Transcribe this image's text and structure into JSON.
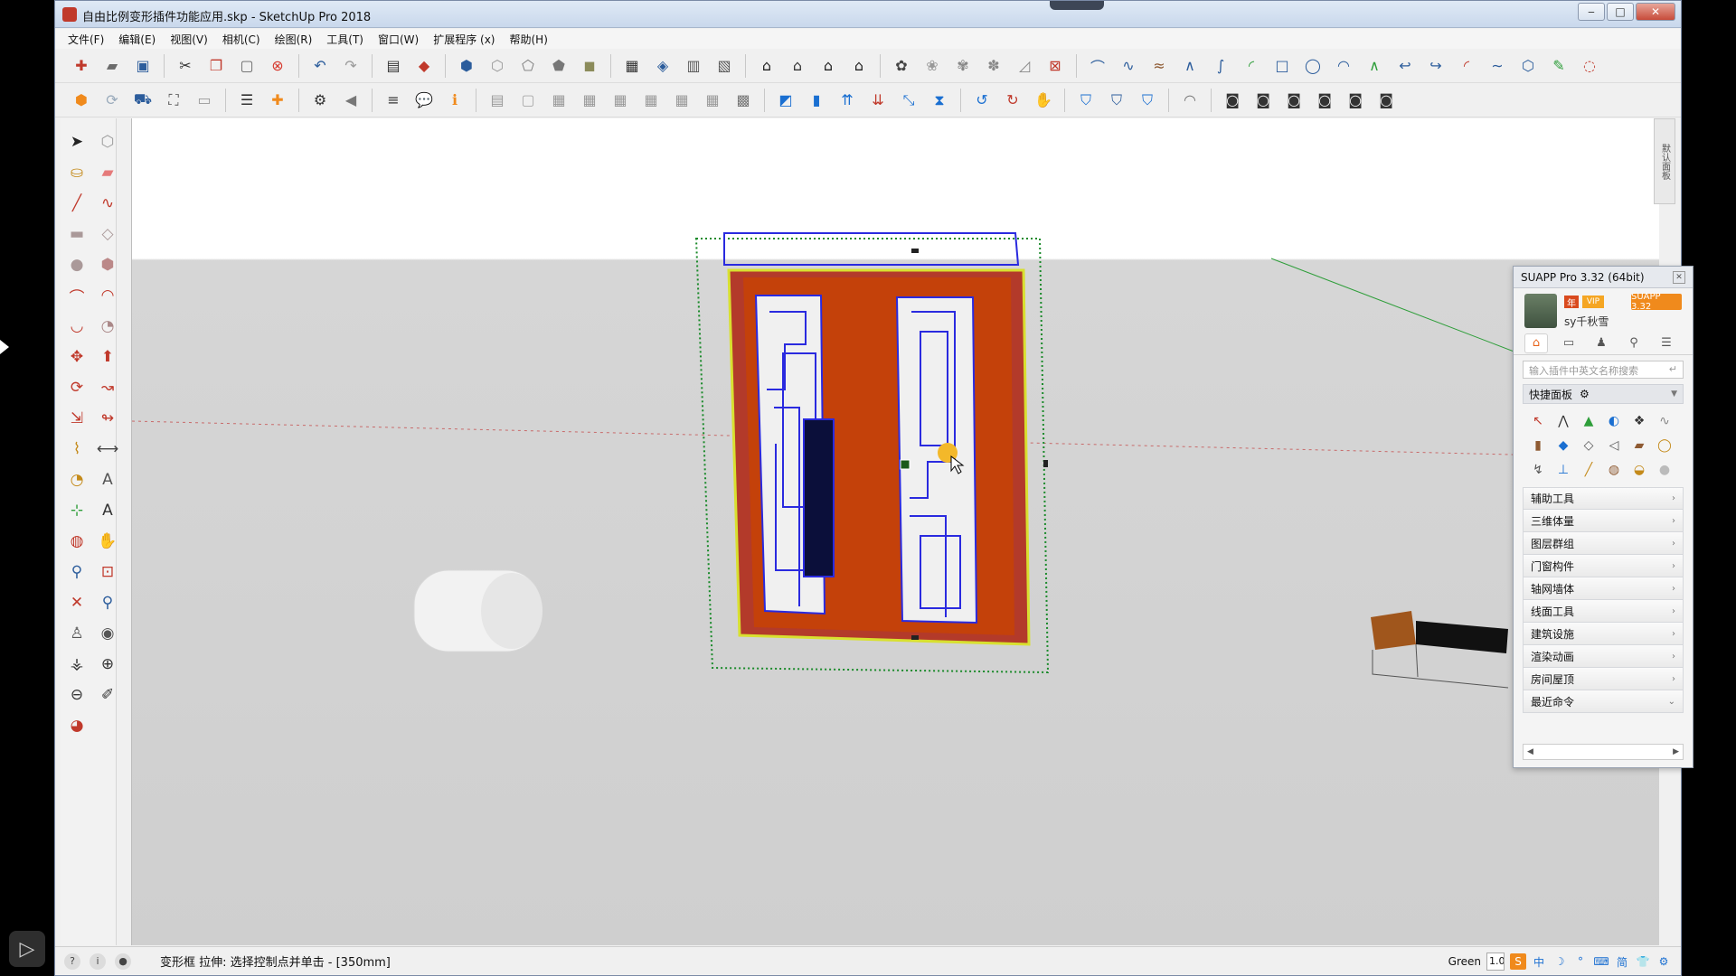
{
  "window": {
    "title": "自由比例变形插件功能应用.skp - SketchUp Pro 2018",
    "controls": {
      "minimize": "‒",
      "maximize": "□",
      "close": "✕"
    }
  },
  "menubar": {
    "items": [
      "文件(F)",
      "编辑(E)",
      "视图(V)",
      "相机(C)",
      "绘图(R)",
      "工具(T)",
      "窗口(W)",
      "扩展程序 (x)",
      "帮助(H)"
    ]
  },
  "toolbar": {
    "row1": [
      {
        "icon": "new-file-icon",
        "glyph": "✚",
        "color": "#c0392b"
      },
      {
        "icon": "open-folder-icon",
        "glyph": "▰",
        "color": "#6b6b6b"
      },
      {
        "icon": "save-icon",
        "glyph": "▣",
        "color": "#2c5d9c"
      },
      {
        "icon": "cut-icon",
        "glyph": "✂",
        "color": "#333"
      },
      {
        "icon": "copy-icon",
        "glyph": "❐",
        "color": "#c0392b"
      },
      {
        "icon": "paste-icon",
        "glyph": "▢",
        "color": "#666"
      },
      {
        "icon": "delete-icon",
        "glyph": "⊗",
        "color": "#d63a2f"
      },
      {
        "icon": "undo-icon",
        "glyph": "↶",
        "color": "#2c5d9c"
      },
      {
        "icon": "redo-icon",
        "glyph": "↷",
        "color": "#9a9a9a"
      },
      {
        "icon": "print-icon",
        "glyph": "▤",
        "color": "#333"
      },
      {
        "icon": "model-info-icon",
        "glyph": "◆",
        "color": "#c0392b"
      },
      {
        "icon": "iso-view-icon",
        "glyph": "⬢",
        "color": "#2c5d9c"
      },
      {
        "icon": "top-view-icon",
        "glyph": "⬡",
        "color": "#999"
      },
      {
        "icon": "front-view-icon",
        "glyph": "⬠",
        "color": "#777"
      },
      {
        "icon": "right-view-icon",
        "glyph": "⬟",
        "color": "#777"
      },
      {
        "icon": "back-view-icon",
        "glyph": "◼",
        "color": "#8b8b5a"
      },
      {
        "icon": "layers-icon",
        "glyph": "▦",
        "color": "#333"
      },
      {
        "icon": "shaded-icon",
        "glyph": "◈",
        "color": "#2c5d9c"
      },
      {
        "icon": "section-plane-icon",
        "glyph": "▥",
        "color": "#555"
      },
      {
        "icon": "section-cut-icon",
        "glyph": "▧",
        "color": "#555"
      },
      {
        "icon": "warehouse-house-icon",
        "glyph": "⌂",
        "color": "#222"
      },
      {
        "icon": "share-model-icon",
        "glyph": "⌂",
        "color": "#333"
      },
      {
        "icon": "extension-warehouse-icon",
        "glyph": "⌂",
        "color": "#222"
      },
      {
        "icon": "share-component-icon",
        "glyph": "⌂",
        "color": "#222"
      },
      {
        "icon": "dynamic-comp-icon",
        "glyph": "✿",
        "color": "#444"
      },
      {
        "icon": "sandbox-smoove-icon",
        "glyph": "❀",
        "color": "#999"
      },
      {
        "icon": "sandbox-stamp-icon",
        "glyph": "✾",
        "color": "#888"
      },
      {
        "icon": "sandbox-drape-icon",
        "glyph": "✽",
        "color": "#888"
      },
      {
        "icon": "sandbox-flip-icon",
        "glyph": "◿",
        "color": "#888"
      },
      {
        "icon": "sandbox-detail-icon",
        "glyph": "⊠",
        "color": "#c0392b"
      },
      {
        "icon": "arc-tool-icon",
        "glyph": "⌒",
        "color": "#2c5d9c"
      },
      {
        "icon": "zigzag-line-icon",
        "glyph": "∿",
        "color": "#2c5d9c"
      },
      {
        "icon": "bezier-icon",
        "glyph": "≈",
        "color": "#8e5a32"
      },
      {
        "icon": "polyline-icon",
        "glyph": "∧",
        "color": "#2c5d9c"
      },
      {
        "icon": "sine-curve-icon",
        "glyph": "∫",
        "color": "#2c5d9c"
      },
      {
        "icon": "arc-green-icon",
        "glyph": "◜",
        "color": "#2e9e3a"
      },
      {
        "icon": "rect-outline-icon",
        "glyph": "□",
        "color": "#2c5d9c"
      },
      {
        "icon": "circle-outline-icon",
        "glyph": "◯",
        "color": "#2c5d9c"
      },
      {
        "icon": "half-arc-icon",
        "glyph": "◠",
        "color": "#2c5d9c"
      },
      {
        "icon": "zigzag-green-icon",
        "glyph": "∧",
        "color": "#2e9e3a"
      },
      {
        "icon": "curve-right-icon",
        "glyph": "↩",
        "color": "#2c5d9c"
      },
      {
        "icon": "curve-left-icon",
        "glyph": "↪",
        "color": "#2c5d9c"
      },
      {
        "icon": "arc-red-icon",
        "glyph": "◜",
        "color": "#c0392b"
      },
      {
        "icon": "freehand-curve-icon",
        "glyph": "∼",
        "color": "#2c5d9c"
      },
      {
        "icon": "polygon-icon",
        "glyph": "⬡",
        "color": "#2c5d9c"
      },
      {
        "icon": "wrench-icon",
        "glyph": "✎",
        "color": "#2e9e3a"
      },
      {
        "icon": "spiral-icon",
        "glyph": "◌",
        "color": "#c0392b"
      }
    ],
    "row2": [
      {
        "icon": "suapp-shield-icon",
        "glyph": "⬢",
        "color": "#f08a1c"
      },
      {
        "icon": "refresh-icon",
        "glyph": "⟳",
        "color": "#9ab"
      },
      {
        "icon": "paint-tray-icon",
        "glyph": "⛟",
        "color": "#2c5d9c"
      },
      {
        "icon": "camera-scene-icon",
        "glyph": "⛶",
        "color": "#555"
      },
      {
        "icon": "photo-icon",
        "glyph": "▭",
        "color": "#999"
      },
      {
        "icon": "stack-icon",
        "glyph": "☰",
        "color": "#333"
      },
      {
        "icon": "suapp-plus-icon",
        "glyph": "✚",
        "color": "#f08a1c"
      },
      {
        "icon": "gear-settings-icon",
        "glyph": "⚙",
        "color": "#333"
      },
      {
        "icon": "speaker-icon",
        "glyph": "◀",
        "color": "#777"
      },
      {
        "icon": "sliders-icon",
        "glyph": "≡",
        "color": "#333"
      },
      {
        "icon": "chat-icon",
        "glyph": "💬",
        "color": "#555"
      },
      {
        "icon": "info-card-icon",
        "glyph": "ℹ",
        "color": "#f08a1c"
      },
      {
        "icon": "doc-gray-icon",
        "glyph": "▤",
        "color": "#999"
      },
      {
        "icon": "doc-page-icon",
        "glyph": "▢",
        "color": "#aaa"
      },
      {
        "icon": "layout-a-icon",
        "glyph": "▦",
        "color": "#999"
      },
      {
        "icon": "layout-b-icon",
        "glyph": "▦",
        "color": "#999"
      },
      {
        "icon": "layout-c-icon",
        "glyph": "▦",
        "color": "#999"
      },
      {
        "icon": "layout-d-icon",
        "glyph": "▦",
        "color": "#999"
      },
      {
        "icon": "layout-e-icon",
        "glyph": "▦",
        "color": "#999"
      },
      {
        "icon": "layout-f-icon",
        "glyph": "▦",
        "color": "#999"
      },
      {
        "icon": "image-grid-icon",
        "glyph": "▩",
        "color": "#777"
      },
      {
        "icon": "colorize-icon",
        "glyph": "◩",
        "color": "#1a6fd1"
      },
      {
        "icon": "extrude-icon",
        "glyph": "▮",
        "color": "#1a6fd1"
      },
      {
        "icon": "arrows-up-icon",
        "glyph": "⇈",
        "color": "#1a6fd1"
      },
      {
        "icon": "arrows-down-icon",
        "glyph": "⇊",
        "color": "#c0392b"
      },
      {
        "icon": "diag-arrow-icon",
        "glyph": "⤡",
        "color": "#1a6fd1"
      },
      {
        "icon": "hourglass-icon",
        "glyph": "⧗",
        "color": "#1a6fd1"
      },
      {
        "icon": "rotate-left-icon",
        "glyph": "↺",
        "color": "#1a6fd1"
      },
      {
        "icon": "rotate-right-icon",
        "glyph": "↻",
        "color": "#c0392b"
      },
      {
        "icon": "hand-icon",
        "glyph": "✋",
        "color": "#c0392b"
      },
      {
        "icon": "shield-outline-icon",
        "glyph": "⛉",
        "color": "#1a6fd1"
      },
      {
        "icon": "shield-blue-icon",
        "glyph": "⛉",
        "color": "#2c5d9c"
      },
      {
        "icon": "shield-thin-icon",
        "glyph": "⛉",
        "color": "#1a6fd1"
      },
      {
        "icon": "sweep-icon",
        "glyph": "◠",
        "color": "#777"
      },
      {
        "icon": "group-a-icon",
        "glyph": "◙",
        "color": "#333"
      },
      {
        "icon": "group-b-icon",
        "glyph": "◙",
        "color": "#333"
      },
      {
        "icon": "group-c-icon",
        "glyph": "◙",
        "color": "#333"
      },
      {
        "icon": "group-d-icon",
        "glyph": "◙",
        "color": "#333"
      },
      {
        "icon": "group-e-icon",
        "glyph": "◙",
        "color": "#333"
      },
      {
        "icon": "group-f-icon",
        "glyph": "◙",
        "color": "#333"
      }
    ]
  },
  "left_palette": [
    {
      "icon": "select-arrow-icon",
      "glyph": "➤",
      "color": "#222"
    },
    {
      "icon": "make-component-icon",
      "glyph": "⬡",
      "color": "#999"
    },
    {
      "icon": "paint-bucket-icon",
      "glyph": "⛀",
      "color": "#c48a1a"
    },
    {
      "icon": "eraser-icon",
      "glyph": "▰",
      "color": "#e57a7a"
    },
    {
      "icon": "pencil-line-icon",
      "glyph": "╱",
      "color": "#c0392b"
    },
    {
      "icon": "freehand-icon",
      "glyph": "∿",
      "color": "#c0392b"
    },
    {
      "icon": "rectangle-icon",
      "glyph": "▬",
      "color": "#a99"
    },
    {
      "icon": "rotated-rect-icon",
      "glyph": "◇",
      "color": "#a99"
    },
    {
      "icon": "circle-icon",
      "glyph": "●",
      "color": "#a99"
    },
    {
      "icon": "polygon-tool-icon",
      "glyph": "⬢",
      "color": "#b88"
    },
    {
      "icon": "arc-tool-left-icon",
      "glyph": "⌒",
      "color": "#c0392b"
    },
    {
      "icon": "two-point-arc-icon",
      "glyph": "◠",
      "color": "#c0392b"
    },
    {
      "icon": "three-point-arc-icon",
      "glyph": "◡",
      "color": "#c0392b"
    },
    {
      "icon": "pie-icon",
      "glyph": "◔",
      "color": "#a88"
    },
    {
      "icon": "move-icon",
      "glyph": "✥",
      "color": "#c0392b"
    },
    {
      "icon": "push-pull-icon",
      "glyph": "⬆",
      "color": "#c0392b"
    },
    {
      "icon": "rotate-icon",
      "glyph": "⟳",
      "color": "#c0392b"
    },
    {
      "icon": "follow-me-icon",
      "glyph": "↝",
      "color": "#c0392b"
    },
    {
      "icon": "scale-icon",
      "glyph": "⇲",
      "color": "#c0392b"
    },
    {
      "icon": "offset-icon",
      "glyph": "↬",
      "color": "#c0392b"
    },
    {
      "icon": "tape-measure-icon",
      "glyph": "⌇",
      "color": "#c48a1a"
    },
    {
      "icon": "dimension-icon",
      "glyph": "⟷",
      "color": "#444"
    },
    {
      "icon": "protractor-icon",
      "glyph": "◔",
      "color": "#c48a1a"
    },
    {
      "icon": "text-icon",
      "glyph": "A",
      "color": "#555"
    },
    {
      "icon": "axes-icon",
      "glyph": "⊹",
      "color": "#2e9e3a"
    },
    {
      "icon": "3d-text-icon",
      "glyph": "A",
      "color": "#333"
    },
    {
      "icon": "orbit-icon",
      "glyph": "◍",
      "color": "#c0392b"
    },
    {
      "icon": "pan-icon",
      "glyph": "✋",
      "color": "#c48a1a"
    },
    {
      "icon": "zoom-icon",
      "glyph": "⚲",
      "color": "#2c5d9c"
    },
    {
      "icon": "zoom-window-icon",
      "glyph": "⊡",
      "color": "#c0392b"
    },
    {
      "icon": "zoom-extents-icon",
      "glyph": "✕",
      "color": "#c0392b"
    },
    {
      "icon": "previous-view-icon",
      "glyph": "⚲",
      "color": "#2c5d9c"
    },
    {
      "icon": "position-camera-icon",
      "glyph": "♙",
      "color": "#555"
    },
    {
      "icon": "look-around-icon",
      "glyph": "◉",
      "color": "#555"
    },
    {
      "icon": "walk-icon",
      "glyph": "⚶",
      "color": "#333"
    },
    {
      "icon": "section-plane-left-icon",
      "glyph": "⊕",
      "color": "#333"
    },
    {
      "icon": "compass-icon",
      "glyph": "⊖",
      "color": "#333"
    },
    {
      "icon": "paint-brush-icon",
      "glyph": "✐",
      "color": "#333"
    },
    {
      "icon": "measure-angle-icon",
      "glyph": "◕",
      "color": "#c0392b"
    }
  ],
  "right_strip": {
    "label": "默认面板"
  },
  "suapp": {
    "title": "SUAPP Pro 3.32 (64bit)",
    "badge": "年",
    "vip": "VIP",
    "version": "SUAPP 3.32",
    "username": "sy千秋雪",
    "tabs": [
      "home-icon",
      "folder-icon",
      "user-icon",
      "search-icon",
      "list-icon"
    ],
    "tab_glyphs": [
      "⌂",
      "▭",
      "♟",
      "⚲",
      "☰"
    ],
    "search_placeholder": "输入插件中英文名称搜索",
    "search_enter": "↵",
    "quick_panel": "快捷面板",
    "quick_icons": [
      "↖",
      "⋀",
      "▲",
      "◐",
      "❖",
      "∿",
      "▮",
      "◆",
      "◇",
      "◁",
      "▰",
      "◯",
      "↯",
      "⊥",
      "╱",
      "◍",
      "◒",
      "●"
    ],
    "categories": [
      {
        "label": "辅助工具",
        "chevron": "›"
      },
      {
        "label": "三维体量",
        "chevron": "›"
      },
      {
        "label": "图层群组",
        "chevron": "›"
      },
      {
        "label": "门窗构件",
        "chevron": "›"
      },
      {
        "label": "轴网墙体",
        "chevron": "›"
      },
      {
        "label": "线面工具",
        "chevron": "›"
      },
      {
        "label": "建筑设施",
        "chevron": "›"
      },
      {
        "label": "渲染动画",
        "chevron": "›"
      },
      {
        "label": "房间屋顶",
        "chevron": "›"
      },
      {
        "label": "最近命令",
        "chevron": "⌄"
      }
    ]
  },
  "status": {
    "message": "变形框 拉伸: 选择控制点并单击 - [350mm]",
    "vcb_label": "Green",
    "vcb_value": "1.0",
    "tray": [
      "S",
      "中",
      "☽",
      "°",
      "⌨",
      "简",
      "👕",
      "⚙"
    ]
  },
  "colors": {
    "door_orange": "#c4410a",
    "door_frame_red": "#b33a2a",
    "outline_blue": "#2a2adf",
    "selection_yellow": "#d8e030",
    "bbox_green": "#1a8a2a",
    "suapp_orange": "#f08a1c"
  }
}
